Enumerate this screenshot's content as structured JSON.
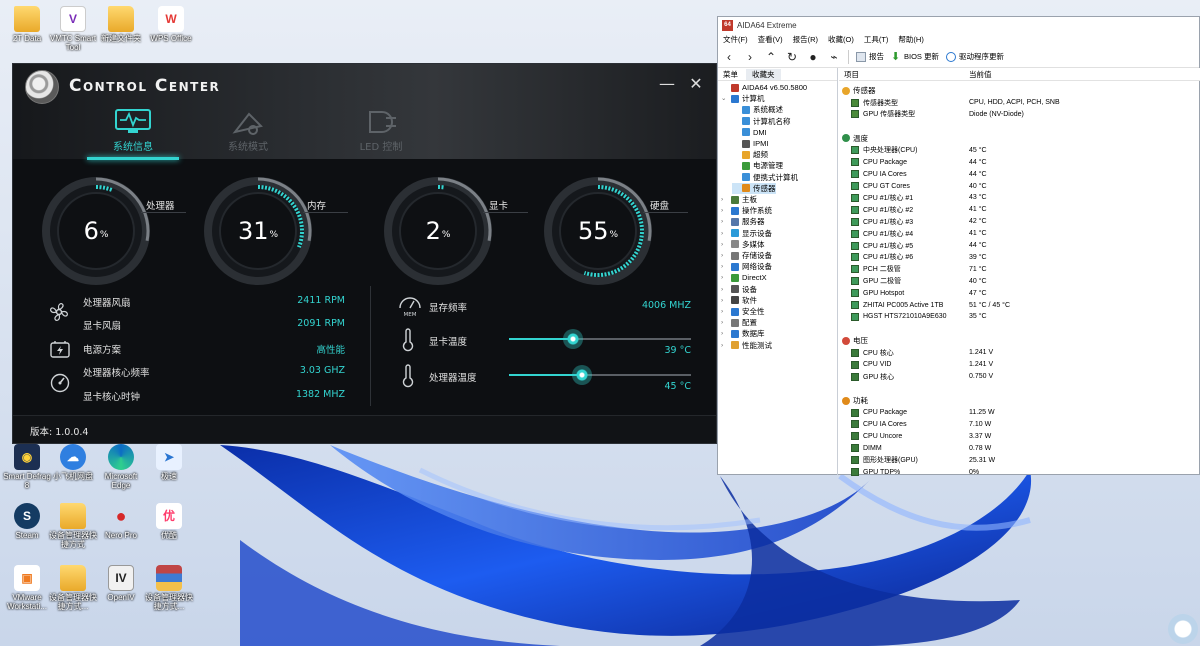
{
  "desktop": {
    "icons": [
      {
        "label": "2T Data",
        "icon": "folder-icon"
      },
      {
        "label": "VMTC Smart Tool",
        "icon": "vmtc-icon"
      },
      {
        "label": "新建文件夹",
        "icon": "folder-icon"
      },
      {
        "label": "WPS Office",
        "icon": "wps-icon"
      },
      {
        "label": "Smart Defrag 8",
        "icon": "defrag-icon"
      },
      {
        "label": "小飞机网盘",
        "icon": "cloud-icon"
      },
      {
        "label": "Microsoft Edge",
        "icon": "edge-icon"
      },
      {
        "label": "极速",
        "icon": "send-icon"
      },
      {
        "label": "Steam",
        "icon": "steam-icon"
      },
      {
        "label": "设备管理器快捷方式",
        "icon": "folder-icon"
      },
      {
        "label": "Nero Pro",
        "icon": "nero-icon"
      },
      {
        "label": "优酷",
        "icon": "youku-icon"
      },
      {
        "label": "VMware Workstati...",
        "icon": "vmware-icon"
      },
      {
        "label": "设备管理器快捷方式...",
        "icon": "folder-icon"
      },
      {
        "label": "OpenIV",
        "icon": "openiv-icon"
      },
      {
        "label": "设备管理器快捷方式...",
        "icon": "zip-icon"
      }
    ]
  },
  "control_center": {
    "title": "Control Center",
    "tabs": [
      {
        "label": "系统信息",
        "active": true
      },
      {
        "label": "系统模式",
        "active": false
      },
      {
        "label": "LED 控制",
        "active": false
      }
    ],
    "gauges": [
      {
        "label": "处理器",
        "value": "6",
        "unit": "%",
        "percent": 6
      },
      {
        "label": "内存",
        "value": "31",
        "unit": "%",
        "percent": 31
      },
      {
        "label": "显卡",
        "value": "2",
        "unit": "%",
        "percent": 2
      },
      {
        "label": "硬盘",
        "value": "55",
        "unit": "%",
        "percent": 55
      }
    ],
    "stats_left": [
      {
        "label": "处理器风扇",
        "value": "2411 RPM",
        "icon": "fan-icon"
      },
      {
        "label": "显卡风扇",
        "value": "2091 RPM",
        "icon": ""
      },
      {
        "label": "电源方案",
        "value": "高性能",
        "icon": "battery-icon"
      },
      {
        "label": "处理器核心频率",
        "value": "3.03 GHZ",
        "icon": "speedometer-icon"
      },
      {
        "label": "显卡核心时钟",
        "value": "1382 MHZ",
        "icon": ""
      }
    ],
    "stats_right": {
      "memory_freq": {
        "label": "显存频率",
        "value": "4006 MHZ",
        "icon_text": "MEM"
      },
      "gpu_temp": {
        "label": "显卡温度",
        "value": "39 °C",
        "level": 0.35
      },
      "cpu_temp": {
        "label": "处理器温度",
        "value": "45 °C",
        "level": 0.4
      }
    },
    "version": "版本: 1.0.0.4",
    "accent_color": "#33d4d0"
  },
  "aida": {
    "window_title": "AIDA64 Extreme",
    "menu": [
      "文件(F)",
      "查看(V)",
      "报告(R)",
      "收藏(O)",
      "工具(T)",
      "帮助(H)"
    ],
    "toolbar": {
      "report": "报告",
      "bios": "BIOS 更新",
      "driver": "驱动程序更新"
    },
    "left_tabs": [
      "菜单",
      "收藏夹"
    ],
    "tree": [
      {
        "label": "AIDA64 v6.50.5800",
        "level": 0,
        "expander": "",
        "color": "#c0392b"
      },
      {
        "label": "计算机",
        "level": 0,
        "expander": "⌄",
        "color": "#2b78d0"
      },
      {
        "label": "系统概述",
        "level": 1,
        "expander": "",
        "color": "#3a8fd8"
      },
      {
        "label": "计算机名称",
        "level": 1,
        "expander": "",
        "color": "#3a8fd8"
      },
      {
        "label": "DMI",
        "level": 1,
        "expander": "",
        "color": "#3a8fd8"
      },
      {
        "label": "IPMI",
        "level": 1,
        "expander": "",
        "color": "#555555"
      },
      {
        "label": "超频",
        "level": 1,
        "expander": "",
        "color": "#e8a52a"
      },
      {
        "label": "电源管理",
        "level": 1,
        "expander": "",
        "color": "#3b9b3b"
      },
      {
        "label": "便携式计算机",
        "level": 1,
        "expander": "",
        "color": "#3a8fd8"
      },
      {
        "label": "传感器",
        "level": 1,
        "expander": "",
        "color": "#e08a1a",
        "selected": true
      },
      {
        "label": "主板",
        "level": 0,
        "expander": "›",
        "color": "#4a7a3a"
      },
      {
        "label": "操作系统",
        "level": 0,
        "expander": "›",
        "color": "#2b78d0"
      },
      {
        "label": "服务器",
        "level": 0,
        "expander": "›",
        "color": "#5577aa"
      },
      {
        "label": "显示设备",
        "level": 0,
        "expander": "›",
        "color": "#2b9ad8"
      },
      {
        "label": "多媒体",
        "level": 0,
        "expander": "›",
        "color": "#888888"
      },
      {
        "label": "存储设备",
        "level": 0,
        "expander": "›",
        "color": "#777777"
      },
      {
        "label": "网络设备",
        "level": 0,
        "expander": "›",
        "color": "#2b78d0"
      },
      {
        "label": "DirectX",
        "level": 0,
        "expander": "›",
        "color": "#3a9a3a"
      },
      {
        "label": "设备",
        "level": 0,
        "expander": "›",
        "color": "#555555"
      },
      {
        "label": "软件",
        "level": 0,
        "expander": "›",
        "color": "#444444"
      },
      {
        "label": "安全性",
        "level": 0,
        "expander": "›",
        "color": "#2b78d0"
      },
      {
        "label": "配置",
        "level": 0,
        "expander": "›",
        "color": "#777777"
      },
      {
        "label": "数据库",
        "level": 0,
        "expander": "›",
        "color": "#2b78d0"
      },
      {
        "label": "性能测试",
        "level": 0,
        "expander": "›",
        "color": "#e0a030"
      }
    ],
    "columns": [
      "项目",
      "当前值"
    ],
    "sections": [
      {
        "title": "传感器",
        "rows": [
          {
            "name": "传感器类型",
            "value": "CPU, HDD, ACPI, PCH, SNB"
          },
          {
            "name": "GPU 传感器类型",
            "value": "Diode  (NV-Diode)"
          }
        ]
      },
      {
        "title": "温度",
        "rows": [
          {
            "name": "中央处理器(CPU)",
            "value": "45 °C"
          },
          {
            "name": "CPU Package",
            "value": "44 °C"
          },
          {
            "name": "CPU IA Cores",
            "value": "44 °C"
          },
          {
            "name": "CPU GT Cores",
            "value": "40 °C"
          },
          {
            "name": "CPU #1/核心 #1",
            "value": "43 °C"
          },
          {
            "name": "CPU #1/核心 #2",
            "value": "41 °C"
          },
          {
            "name": "CPU #1/核心 #3",
            "value": "42 °C"
          },
          {
            "name": "CPU #1/核心 #4",
            "value": "41 °C"
          },
          {
            "name": "CPU #1/核心 #5",
            "value": "44 °C"
          },
          {
            "name": "CPU #1/核心 #6",
            "value": "39 °C"
          },
          {
            "name": "PCH 二极管",
            "value": "71 °C"
          },
          {
            "name": "GPU 二极管",
            "value": "40 °C"
          },
          {
            "name": "GPU Hotspot",
            "value": "47 °C"
          },
          {
            "name": "ZHITAI PC005 Active 1TB",
            "value": "51 °C / 45 °C"
          },
          {
            "name": "HGST HTS721010A9E630",
            "value": "35 °C"
          }
        ]
      },
      {
        "title": "电压",
        "rows": [
          {
            "name": "CPU 核心",
            "value": "1.241 V"
          },
          {
            "name": "CPU VID",
            "value": "1.241 V"
          },
          {
            "name": "GPU 核心",
            "value": "0.750 V"
          }
        ]
      },
      {
        "title": "功耗",
        "rows": [
          {
            "name": "CPU Package",
            "value": "11.25 W"
          },
          {
            "name": "CPU IA Cores",
            "value": "7.10 W"
          },
          {
            "name": "CPU Uncore",
            "value": "3.37 W"
          },
          {
            "name": "DIMM",
            "value": "0.78 W"
          },
          {
            "name": "图形处理器(GPU)",
            "value": "25.31 W"
          },
          {
            "name": "GPU TDP%",
            "value": "0%"
          }
        ]
      }
    ]
  }
}
